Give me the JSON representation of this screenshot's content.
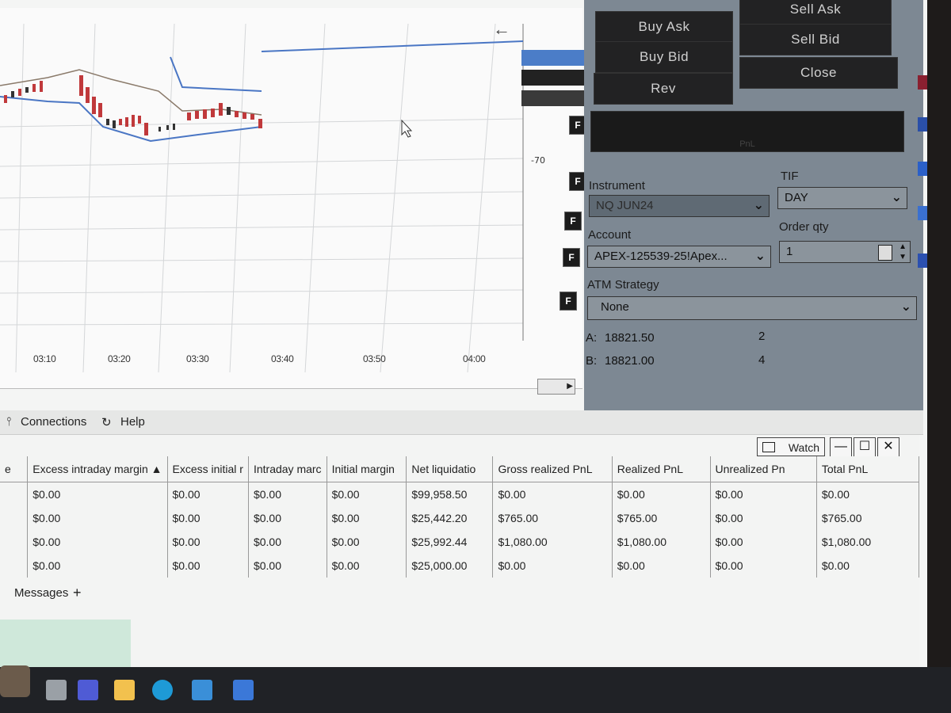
{
  "chart": {
    "back_arrow": "←",
    "price_label": "-70",
    "f_label": "F",
    "time_labels": [
      "03:10",
      "03:20",
      "03:30",
      "03:40",
      "03:50",
      "04:00"
    ]
  },
  "order_panel": {
    "buttons": {
      "buy_ask": "Buy Ask",
      "sell_ask": "Sell Ask",
      "buy_bid": "Buy Bid",
      "sell_bid": "Sell Bid",
      "rev": "Rev",
      "close": "Close"
    },
    "pnl_label": "PnL",
    "instrument_label": "Instrument",
    "instrument_value": "NQ JUN24",
    "tif_label": "TIF",
    "tif_value": "DAY",
    "account_label": "Account",
    "account_value": "APEX-125539-25!Apex...",
    "order_qty_label": "Order qty",
    "order_qty_value": "1",
    "atm_label": "ATM Strategy",
    "atm_value": "None",
    "ask_label": "A:",
    "ask_price": "18821.50",
    "ask_size": "2",
    "bid_label": "B:",
    "bid_price": "18821.00",
    "bid_size": "4"
  },
  "toolbar": {
    "connections": "Connections",
    "help": "Help"
  },
  "accounts_window": {
    "watch_label": "Watch",
    "columns": [
      "e",
      "Excess intraday margin ▲",
      "Excess initial r",
      "Intraday marc",
      "Initial margin",
      "Net liquidatio",
      "Gross realized PnL",
      "Realized PnL",
      "Unrealized Pn",
      "Total PnL"
    ],
    "rows": [
      [
        "",
        "$0.00",
        "$0.00",
        "$0.00",
        "$0.00",
        "$99,958.50",
        "$0.00",
        "$0.00",
        "$0.00",
        "$0.00"
      ],
      [
        "",
        "$0.00",
        "$0.00",
        "$0.00",
        "$0.00",
        "$25,442.20",
        "$765.00",
        "$765.00",
        "$0.00",
        "$765.00"
      ],
      [
        "",
        "$0.00",
        "$0.00",
        "$0.00",
        "$0.00",
        "$25,992.44",
        "$1,080.00",
        "$1,080.00",
        "$0.00",
        "$1,080.00"
      ],
      [
        "",
        "$0.00",
        "$0.00",
        "$0.00",
        "$0.00",
        "$25,000.00",
        "$0.00",
        "$0.00",
        "$0.00",
        "$0.00"
      ]
    ],
    "positive_color": "#3f9b4a"
  },
  "bottom_tabs": {
    "messages": "Messages",
    "add": "+"
  }
}
